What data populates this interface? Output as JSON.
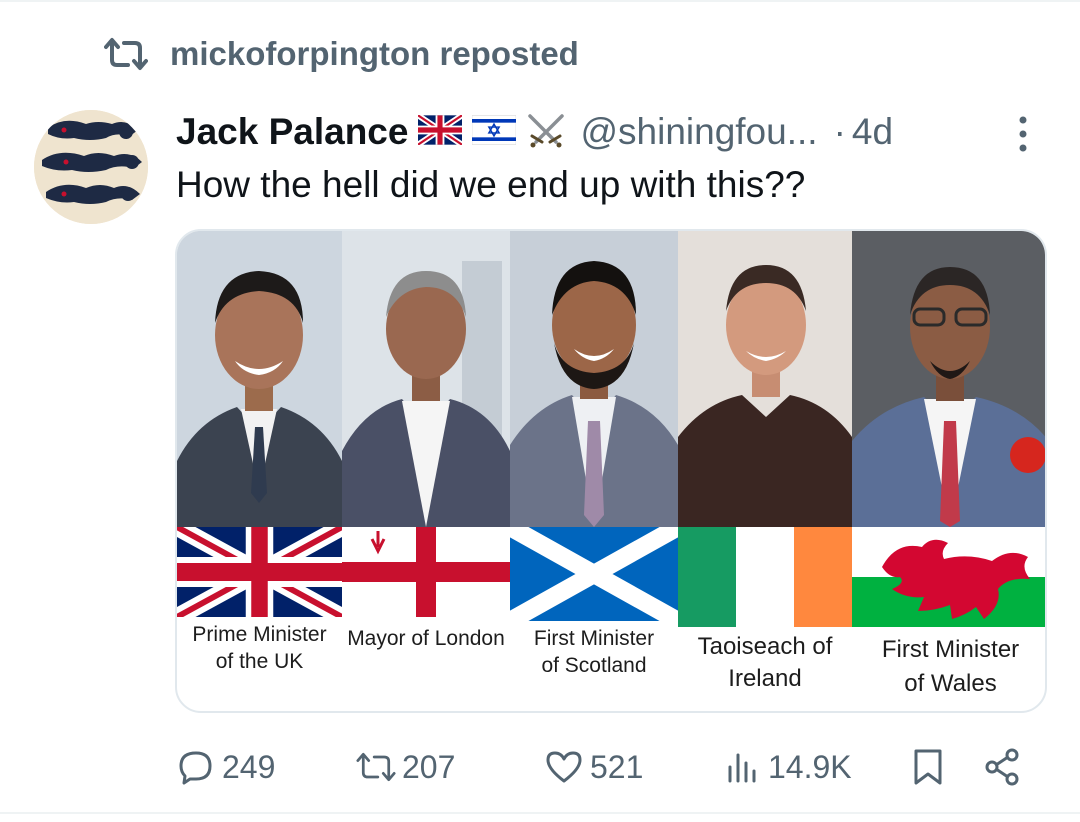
{
  "repost": {
    "icon": "repost-icon",
    "text": "mickoforpington reposted"
  },
  "author": {
    "avatar_icon": "three-lions-avatar",
    "name": "Jack Palance",
    "badges": [
      "uk-flag-emoji",
      "israel-flag-emoji",
      "crossed-swords-emoji"
    ],
    "handle": "@shiningfou...",
    "separator": "·",
    "time": "4d"
  },
  "tweet": {
    "text": "How the hell did we end up with this??"
  },
  "media": {
    "captions": [
      {
        "line1": "Prime Minister",
        "line2": "of the UK"
      },
      {
        "line1": "Mayor of London",
        "line2": ""
      },
      {
        "line1": "First Minister",
        "line2": "of Scotland"
      },
      {
        "line1": "Taoiseach of",
        "line2": "Ireland"
      },
      {
        "line1": "First Minister",
        "line2": "of Wales"
      }
    ],
    "flags": [
      "union-jack-flag",
      "city-of-london-flag",
      "saltire-flag",
      "ireland-flag",
      "wales-dragon-flag"
    ]
  },
  "actions": {
    "replies": "249",
    "reposts": "207",
    "likes": "521",
    "views": "14.9K"
  },
  "colors": {
    "muted": "#536471",
    "text": "#0f1419",
    "border": "#e1e8ed"
  }
}
